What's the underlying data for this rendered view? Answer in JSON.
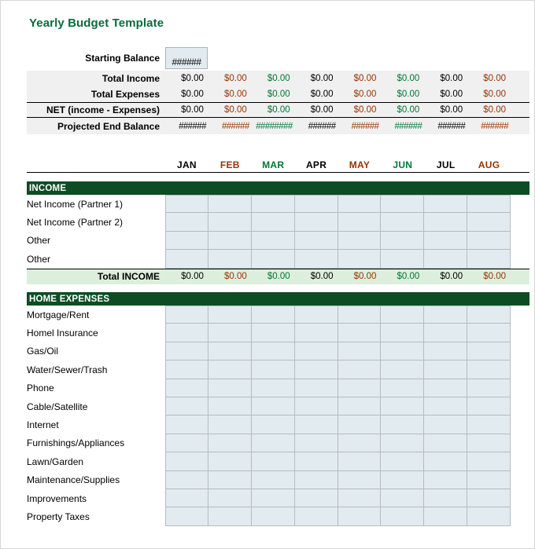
{
  "title": "Yearly Budget Template",
  "colors": {
    "title_green": "#0a6b3d",
    "band_green": "#0d4d23",
    "total_band": "#dcefdc",
    "cell_blue": "#e2ebf0",
    "text_black": "#000000",
    "text_red": "#993300",
    "text_green": "#007733"
  },
  "months": [
    {
      "label": "JAN",
      "color": "black"
    },
    {
      "label": "FEB",
      "color": "red"
    },
    {
      "label": "MAR",
      "color": "green"
    },
    {
      "label": "APR",
      "color": "black"
    },
    {
      "label": "MAY",
      "color": "red"
    },
    {
      "label": "JUN",
      "color": "green"
    },
    {
      "label": "JUL",
      "color": "black"
    },
    {
      "label": "AUG",
      "color": "red"
    }
  ],
  "starting_balance": {
    "label": "Starting Balance",
    "value": "######"
  },
  "summary": {
    "rows": [
      {
        "label": "Total Income",
        "values": [
          "$0.00",
          "$0.00",
          "$0.00",
          "$0.00",
          "$0.00",
          "$0.00",
          "$0.00",
          "$0.00"
        ]
      },
      {
        "label": "Total Expenses",
        "values": [
          "$0.00",
          "$0.00",
          "$0.00",
          "$0.00",
          "$0.00",
          "$0.00",
          "$0.00",
          "$0.00"
        ]
      },
      {
        "label": "NET (income - Expenses)",
        "values": [
          "$0.00",
          "$0.00",
          "$0.00",
          "$0.00",
          "$0.00",
          "$0.00",
          "$0.00",
          "$0.00"
        ]
      },
      {
        "label": "Projected End Balance",
        "values": [
          "######",
          "######",
          "########",
          "######",
          "######",
          "######",
          "######",
          "######"
        ]
      }
    ]
  },
  "income_section": {
    "band_label": "INCOME",
    "rows": [
      "Net Income  (Partner 1)",
      "Net Income (Partner 2)",
      "Other",
      "Other"
    ],
    "total": {
      "label": "Total INCOME",
      "values": [
        "$0.00",
        "$0.00",
        "$0.00",
        "$0.00",
        "$0.00",
        "$0.00",
        "$0.00",
        "$0.00"
      ]
    }
  },
  "home_expenses_section": {
    "band_label": "HOME EXPENSES",
    "rows": [
      "Mortgage/Rent",
      "Homel Insurance",
      "Gas/Oil",
      "Water/Sewer/Trash",
      "Phone",
      "Cable/Satellite",
      "Internet",
      "Furnishings/Appliances",
      "Lawn/Garden",
      "Maintenance/Supplies",
      "Improvements",
      "Property Taxes"
    ]
  }
}
